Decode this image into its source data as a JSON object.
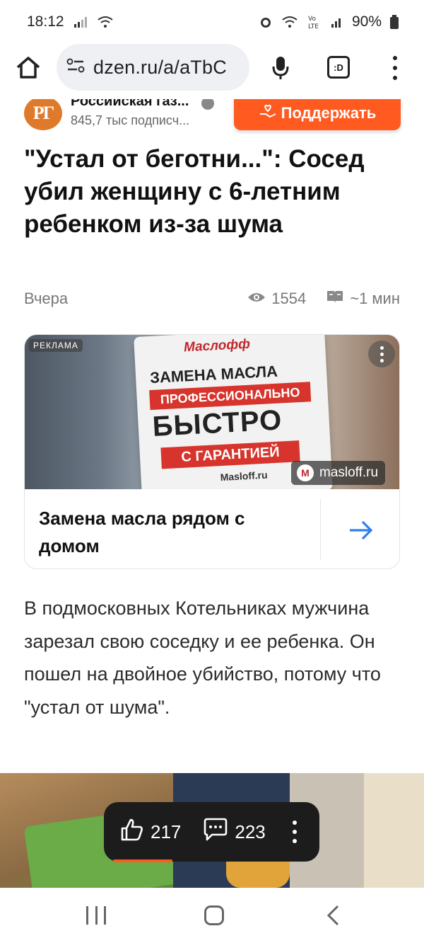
{
  "status": {
    "time": "18:12",
    "battery": "90%"
  },
  "browser": {
    "url": "dzen.ru/a/aTbC",
    "tabs_label": ":D"
  },
  "channel": {
    "logo": "РГ",
    "name": "Российская газ...",
    "subscribers": "845,7 тыс подписч...",
    "support_label": "Поддержать"
  },
  "article": {
    "headline": "\"Устал от беготни...\": Сосед убил женщину с 6-летним ребенком из-за шума",
    "date": "Вчера",
    "views": "1554",
    "read_time": "~1 мин",
    "body": "В подмосковных Котельниках мужчина зарезал свою соседку и ее ребенка. Он пошел на двойное убийство, потому что \"устал от шума\"."
  },
  "ad": {
    "label": "РЕКЛАМА",
    "brand": "Маслофф",
    "bag_line1": "ЗАМЕНА МАСЛА",
    "bag_line2": "ПРОФЕССИОНАЛЬНО",
    "bag_line3": "БЫСТРО",
    "bag_line4": "С ГАРАНТИЕЙ",
    "bag_site": "Masloff.ru",
    "source": "masloff.ru",
    "title": "Замена масла рядом с домом"
  },
  "actions": {
    "likes": "217",
    "comments": "223"
  },
  "colors": {
    "accent": "#ff5a1f",
    "link": "#2f7ff0"
  }
}
